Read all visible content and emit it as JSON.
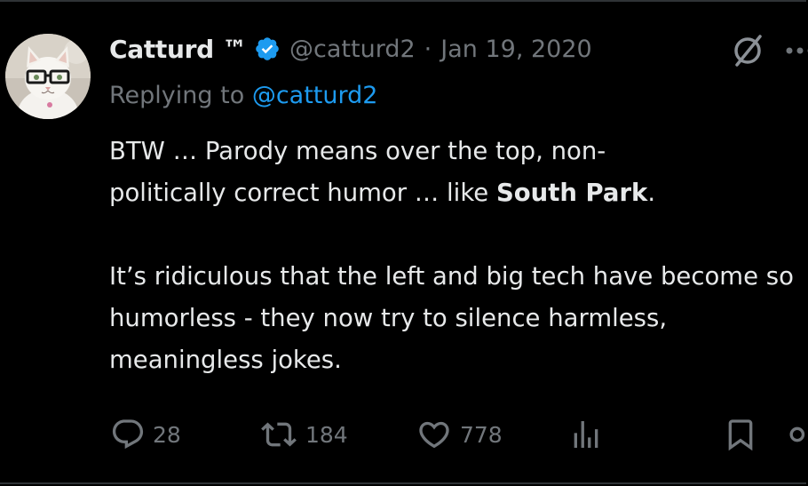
{
  "tweet": {
    "display_name": "Catturd ™",
    "handle": "@catturd2",
    "separator": "·",
    "date": "Jan 19, 2020",
    "replying_to_label": "Replying to",
    "replying_to_handle": "@catturd2",
    "body": {
      "line1_part1": "BTW … Parody means over the top, non-",
      "line2_part1": "politically correct humor … like ",
      "line2_bold": "South Park",
      "line2_part2": ".",
      "para2": "It’s ridiculous that the left and big tech have become so humorless  - they now try to silence harmless, meaningless jokes."
    }
  },
  "actions": {
    "replies": "28",
    "retweets": "184",
    "likes": "778"
  },
  "icons": {
    "verified": "verified-badge-icon",
    "grok": "grok-icon",
    "more": "more-icon",
    "reply": "reply-icon",
    "retweet": "retweet-icon",
    "like": "heart-icon",
    "views": "analytics-icon",
    "bookmark": "bookmark-icon",
    "share": "share-icon"
  },
  "colors": {
    "background": "#000000",
    "text": "#e7e9ea",
    "muted": "#71767b",
    "accent": "#1d9bf0"
  }
}
